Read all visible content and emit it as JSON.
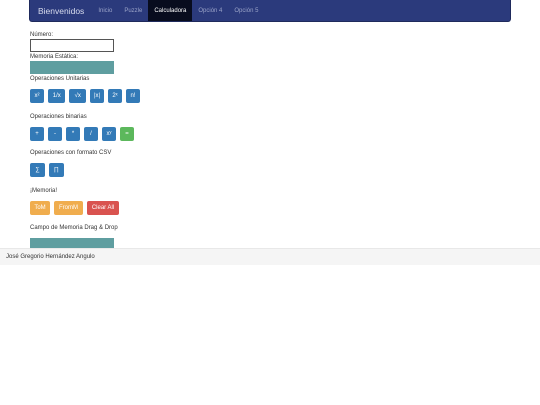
{
  "navbar": {
    "brand": "Bienvenidos",
    "items": [
      "Inicio",
      "Puzzle",
      "Calculadora",
      "Opción 4",
      "Opción 5"
    ],
    "active_index": 2
  },
  "fields": {
    "numero_label": "Número:",
    "numero_value": "",
    "memoria_label": "Memoria Estática:"
  },
  "unarias": {
    "title": "Operaciones Unitarias",
    "buttons": [
      "x²",
      "1/x",
      "√x",
      "|x|",
      "2ˣ",
      "n!"
    ]
  },
  "binarias": {
    "title": "Operaciones binarias",
    "buttons": [
      "+",
      "-",
      "*",
      "/",
      "xʸ",
      "="
    ]
  },
  "csv": {
    "title": "Operaciones con formato CSV",
    "buttons": [
      "∑",
      "∏"
    ]
  },
  "memoria": {
    "title": "¡Memoria!",
    "tom": "ToM",
    "fromm": "FromM",
    "clear": "Clear All"
  },
  "dragdrop": {
    "title": "Campo de Memoria Drag & Drop"
  },
  "footer": {
    "text": "José Gregorio Hernández Angulo"
  },
  "colors": {
    "navbar": "#2b3a7c",
    "primary": "#337ab7",
    "success": "#5cb85c",
    "warning": "#f0ad4e",
    "danger": "#d9534f",
    "teal": "#5f9ea0"
  }
}
